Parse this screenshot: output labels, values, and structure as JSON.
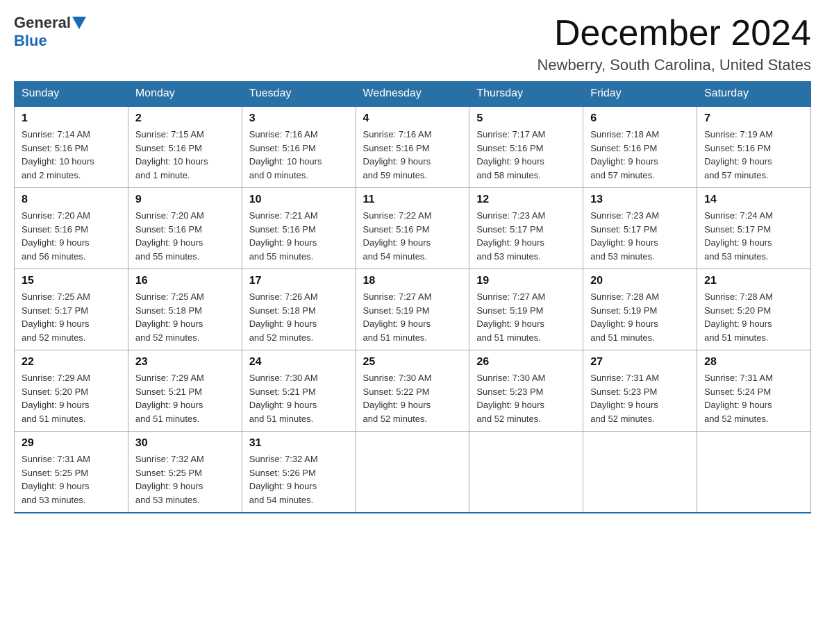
{
  "logo": {
    "general": "General",
    "blue": "Blue"
  },
  "title": "December 2024",
  "subtitle": "Newberry, South Carolina, United States",
  "days_of_week": [
    "Sunday",
    "Monday",
    "Tuesday",
    "Wednesday",
    "Thursday",
    "Friday",
    "Saturday"
  ],
  "weeks": [
    [
      {
        "day": "1",
        "sunrise": "7:14 AM",
        "sunset": "5:16 PM",
        "daylight": "10 hours and 2 minutes."
      },
      {
        "day": "2",
        "sunrise": "7:15 AM",
        "sunset": "5:16 PM",
        "daylight": "10 hours and 1 minute."
      },
      {
        "day": "3",
        "sunrise": "7:16 AM",
        "sunset": "5:16 PM",
        "daylight": "10 hours and 0 minutes."
      },
      {
        "day": "4",
        "sunrise": "7:16 AM",
        "sunset": "5:16 PM",
        "daylight": "9 hours and 59 minutes."
      },
      {
        "day": "5",
        "sunrise": "7:17 AM",
        "sunset": "5:16 PM",
        "daylight": "9 hours and 58 minutes."
      },
      {
        "day": "6",
        "sunrise": "7:18 AM",
        "sunset": "5:16 PM",
        "daylight": "9 hours and 57 minutes."
      },
      {
        "day": "7",
        "sunrise": "7:19 AM",
        "sunset": "5:16 PM",
        "daylight": "9 hours and 57 minutes."
      }
    ],
    [
      {
        "day": "8",
        "sunrise": "7:20 AM",
        "sunset": "5:16 PM",
        "daylight": "9 hours and 56 minutes."
      },
      {
        "day": "9",
        "sunrise": "7:20 AM",
        "sunset": "5:16 PM",
        "daylight": "9 hours and 55 minutes."
      },
      {
        "day": "10",
        "sunrise": "7:21 AM",
        "sunset": "5:16 PM",
        "daylight": "9 hours and 55 minutes."
      },
      {
        "day": "11",
        "sunrise": "7:22 AM",
        "sunset": "5:16 PM",
        "daylight": "9 hours and 54 minutes."
      },
      {
        "day": "12",
        "sunrise": "7:23 AM",
        "sunset": "5:17 PM",
        "daylight": "9 hours and 53 minutes."
      },
      {
        "day": "13",
        "sunrise": "7:23 AM",
        "sunset": "5:17 PM",
        "daylight": "9 hours and 53 minutes."
      },
      {
        "day": "14",
        "sunrise": "7:24 AM",
        "sunset": "5:17 PM",
        "daylight": "9 hours and 53 minutes."
      }
    ],
    [
      {
        "day": "15",
        "sunrise": "7:25 AM",
        "sunset": "5:17 PM",
        "daylight": "9 hours and 52 minutes."
      },
      {
        "day": "16",
        "sunrise": "7:25 AM",
        "sunset": "5:18 PM",
        "daylight": "9 hours and 52 minutes."
      },
      {
        "day": "17",
        "sunrise": "7:26 AM",
        "sunset": "5:18 PM",
        "daylight": "9 hours and 52 minutes."
      },
      {
        "day": "18",
        "sunrise": "7:27 AM",
        "sunset": "5:19 PM",
        "daylight": "9 hours and 51 minutes."
      },
      {
        "day": "19",
        "sunrise": "7:27 AM",
        "sunset": "5:19 PM",
        "daylight": "9 hours and 51 minutes."
      },
      {
        "day": "20",
        "sunrise": "7:28 AM",
        "sunset": "5:19 PM",
        "daylight": "9 hours and 51 minutes."
      },
      {
        "day": "21",
        "sunrise": "7:28 AM",
        "sunset": "5:20 PM",
        "daylight": "9 hours and 51 minutes."
      }
    ],
    [
      {
        "day": "22",
        "sunrise": "7:29 AM",
        "sunset": "5:20 PM",
        "daylight": "9 hours and 51 minutes."
      },
      {
        "day": "23",
        "sunrise": "7:29 AM",
        "sunset": "5:21 PM",
        "daylight": "9 hours and 51 minutes."
      },
      {
        "day": "24",
        "sunrise": "7:30 AM",
        "sunset": "5:21 PM",
        "daylight": "9 hours and 51 minutes."
      },
      {
        "day": "25",
        "sunrise": "7:30 AM",
        "sunset": "5:22 PM",
        "daylight": "9 hours and 52 minutes."
      },
      {
        "day": "26",
        "sunrise": "7:30 AM",
        "sunset": "5:23 PM",
        "daylight": "9 hours and 52 minutes."
      },
      {
        "day": "27",
        "sunrise": "7:31 AM",
        "sunset": "5:23 PM",
        "daylight": "9 hours and 52 minutes."
      },
      {
        "day": "28",
        "sunrise": "7:31 AM",
        "sunset": "5:24 PM",
        "daylight": "9 hours and 52 minutes."
      }
    ],
    [
      {
        "day": "29",
        "sunrise": "7:31 AM",
        "sunset": "5:25 PM",
        "daylight": "9 hours and 53 minutes."
      },
      {
        "day": "30",
        "sunrise": "7:32 AM",
        "sunset": "5:25 PM",
        "daylight": "9 hours and 53 minutes."
      },
      {
        "day": "31",
        "sunrise": "7:32 AM",
        "sunset": "5:26 PM",
        "daylight": "9 hours and 54 minutes."
      },
      null,
      null,
      null,
      null
    ]
  ],
  "labels": {
    "sunrise": "Sunrise:",
    "sunset": "Sunset:",
    "daylight": "Daylight:"
  }
}
